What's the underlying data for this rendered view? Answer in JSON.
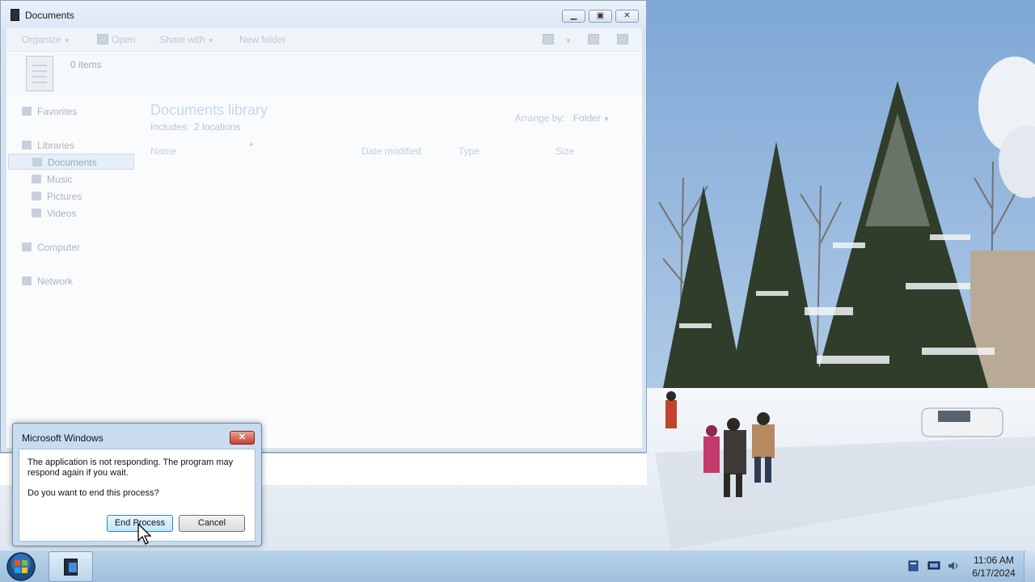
{
  "explorer": {
    "title": "Documents",
    "toolbar": {
      "organize": "Organize",
      "open": "Open",
      "share_with": "Share with",
      "new_folder": "New folder"
    },
    "item_count": "0 items",
    "nav": {
      "favorites": "Favorites",
      "libraries": "Libraries",
      "documents": "Documents",
      "music": "Music",
      "pictures": "Pictures",
      "videos": "Videos",
      "computer": "Computer",
      "network": "Network"
    },
    "library": {
      "title": "Documents library",
      "includes_label": "Includes:",
      "includes_link": "2 locations",
      "arrange_label": "Arrange by:",
      "arrange_value": "Folder"
    },
    "columns": [
      "Name",
      "Date modified",
      "Type",
      "Size"
    ]
  },
  "dialog": {
    "title": "Microsoft Windows",
    "message": "The application is not responding. The program may respond again if you wait.",
    "question": "Do you want to end this process?",
    "primary_button": "End Process",
    "secondary_button": "Cancel"
  },
  "taskbar": {
    "time": "11:06 AM",
    "date": "6/17/2024"
  },
  "colors": {
    "taskbar": "#a9c8e4",
    "dialog_frame": "#c9dcef",
    "close_red": "#c7412c",
    "accent_link": "#a8c2de"
  }
}
